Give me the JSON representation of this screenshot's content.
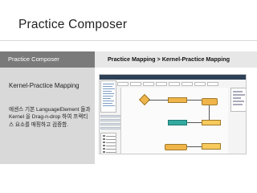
{
  "slide": {
    "title": "Practice Composer"
  },
  "header": {
    "left_label": "Practice Composer",
    "breadcrumb": "Practice Mapping   >   Kernel-Practice Mapping"
  },
  "left_panel": {
    "heading": "Kernel-Practice Mapping",
    "description": "에센스 기본 LanguageElement 들과 Kernel 을 Drag-n-drop 하여 프랙티스 요소를 매핑하고 검증함."
  },
  "colors": {
    "header_left_bg": "#7a7a7a",
    "header_right_bg": "#e7e7e7",
    "panel_bg": "#d9d9d9",
    "app_topbar": "#2e4057",
    "node_orange": "#f0b54a",
    "node_teal": "#33a9a0"
  }
}
